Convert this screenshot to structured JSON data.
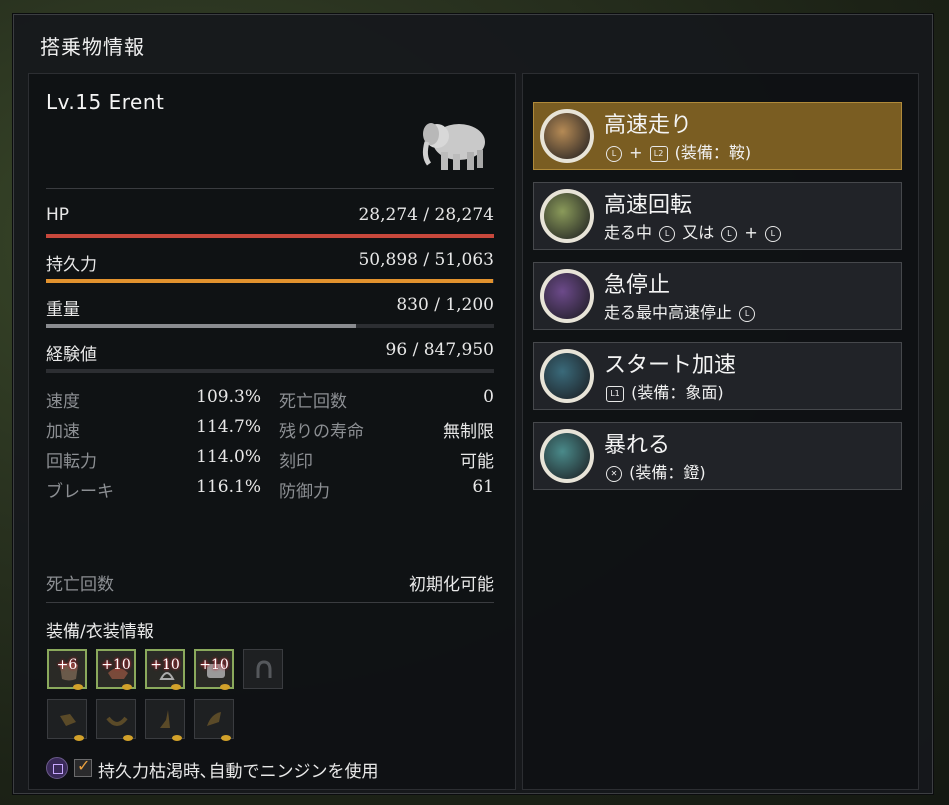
{
  "window": {
    "title": "搭乗物情報"
  },
  "mount": {
    "name": "Lv.15  Erent"
  },
  "stats": {
    "hp": {
      "label": "HP",
      "value": "28,274 / 28,274",
      "ratio": 1.0,
      "color": "#c8483c"
    },
    "stamina": {
      "label": "持久力",
      "value": "50,898 / 51,063",
      "ratio": 0.997,
      "color": "#e2922e"
    },
    "weight": {
      "label": "重量",
      "value": "830 / 1,200",
      "ratio": 0.692,
      "color": "#8a8c90"
    },
    "exp": {
      "label": "経験値",
      "value": "96 / 847,950",
      "ratio": 0.0001,
      "color": "#8a8c90"
    }
  },
  "attributes": [
    {
      "label": "速度",
      "value": "109.3%"
    },
    {
      "label": "加速",
      "value": "114.7%"
    },
    {
      "label": "回転力",
      "value": "114.0%"
    },
    {
      "label": "ブレーキ",
      "value": "116.1%"
    }
  ],
  "info": [
    {
      "label": "死亡回数",
      "value": "0"
    },
    {
      "label": "残りの寿命",
      "value": "無制限"
    },
    {
      "label": "刻印",
      "value": "可能"
    },
    {
      "label": "防御力",
      "value": "61"
    }
  ],
  "reset": {
    "label": "死亡回数",
    "value": "初期化可能"
  },
  "equipment": {
    "title": "装備/衣装情報",
    "row1": [
      "+6",
      "+10",
      "+10",
      "+10",
      ""
    ],
    "row1_icons": [
      "barding-icon",
      "saddle-icon",
      "stirrup-icon",
      "horseshoe-armor-icon",
      "horseshoe-icon"
    ],
    "row2_icons": [
      "costume-head-icon",
      "costume-saddle-icon",
      "costume-stirrup-icon",
      "costume-feet-icon"
    ]
  },
  "footer": {
    "key_icon": "square-button-icon",
    "label": "持久力枯渇時､自動でニンジンを使用"
  },
  "skills": [
    {
      "name": "高速走り",
      "key": "+ (装備：鞍)",
      "active": true,
      "icon_color": "#b58a55"
    },
    {
      "name": "高速回転",
      "key": "走る中 又は + ",
      "active": false,
      "icon_color": "#8a9a5a"
    },
    {
      "name": "急停止",
      "key": "走る最中高速停止",
      "active": false,
      "icon_color": "#6c4a8a"
    },
    {
      "name": "スタート加速",
      "key": "(装備：象面)",
      "active": false,
      "icon_color": "#3a6a7a"
    },
    {
      "name": "暴れる",
      "key": "(装備：鐙)",
      "active": false,
      "icon_color": "#4a8a8a"
    }
  ]
}
